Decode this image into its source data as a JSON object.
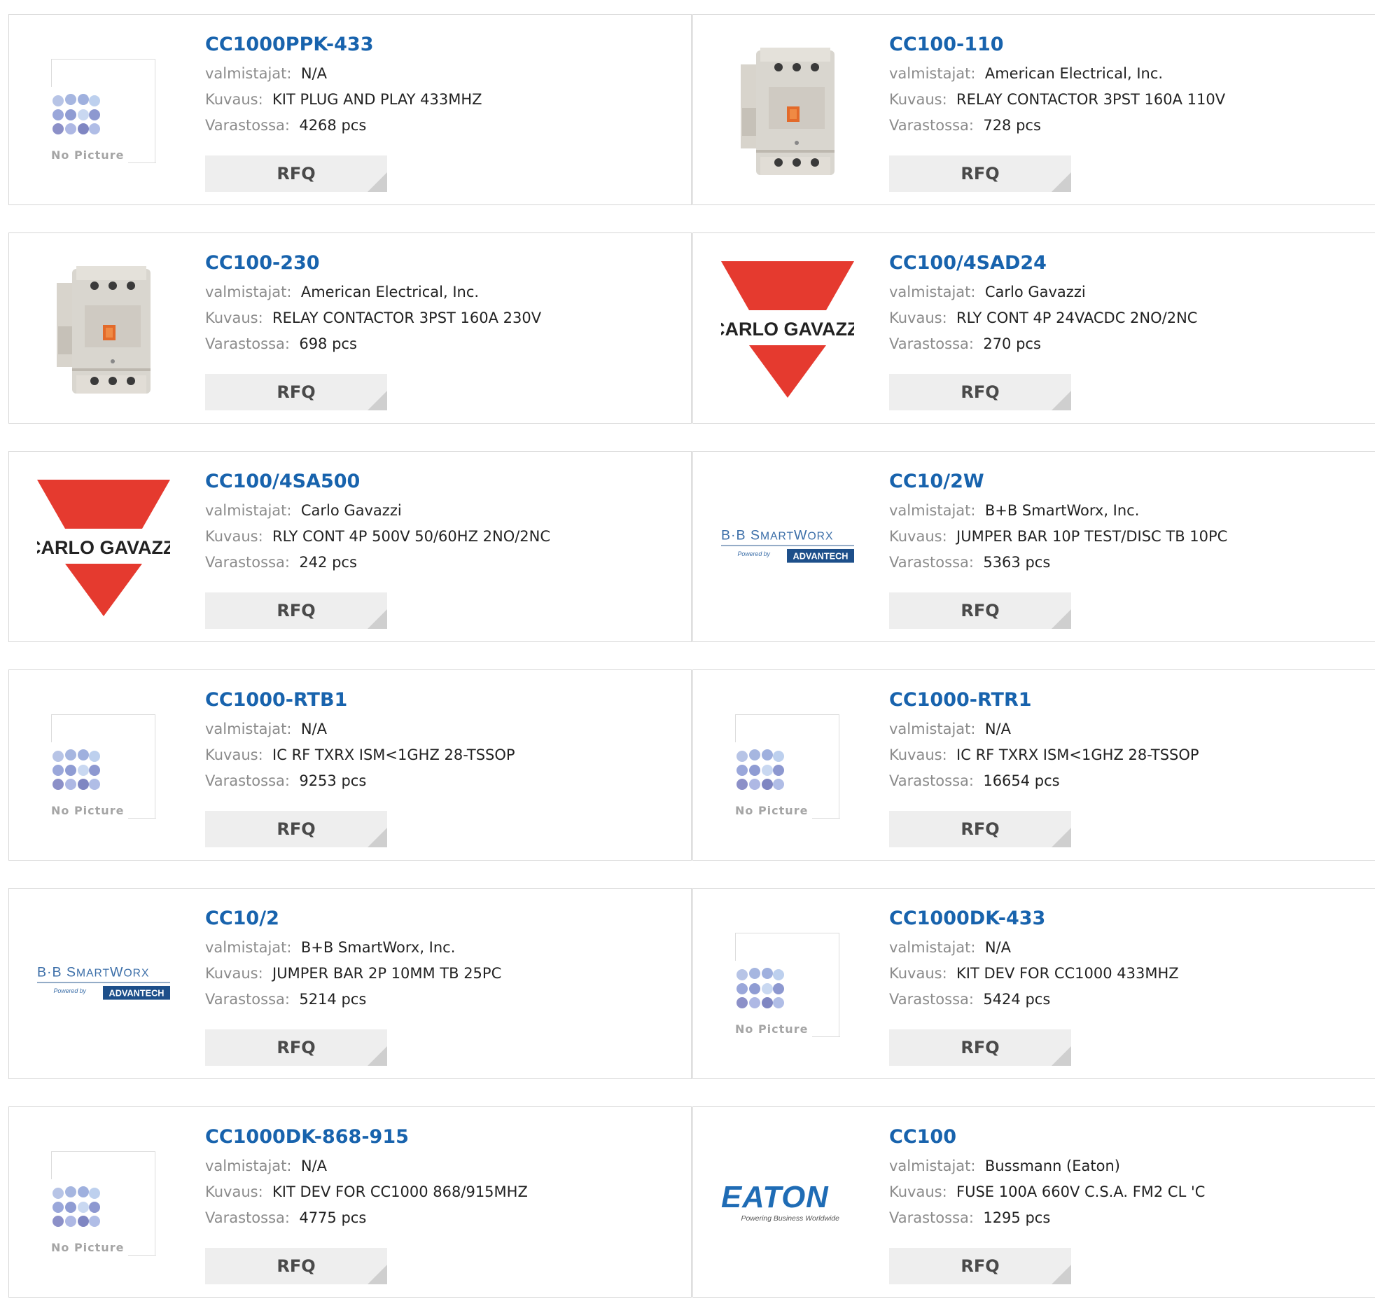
{
  "labels": {
    "manufacturer": "valmistajat:",
    "description": "Kuvaus:",
    "stock": "Varastossa:",
    "rfq": "RFQ",
    "no_picture": "No Picture"
  },
  "brands": {
    "carlo_gavazzi": "CARLO GAVAZZI",
    "bb_top": "B·B SmartWorx",
    "bb_powered": "Powered by",
    "bb_advantech": "ADVANTECH",
    "eaton": "EATON",
    "eaton_tagline": "Powering Business Worldwide"
  },
  "colors": {
    "link": "#1863ad",
    "carlo_red": "#e53a2f",
    "eaton_blue": "#1f6cb5"
  },
  "products": [
    {
      "part": "CC1000PPK-433",
      "manufacturer": "N/A",
      "description": "KIT PLUG AND PLAY 433MHZ",
      "stock": "4268 pcs",
      "image": "no-picture"
    },
    {
      "part": "CC100-110",
      "manufacturer": "American Electrical, Inc.",
      "description": "RELAY CONTACTOR 3PST 160A 110V",
      "stock": "728 pcs",
      "image": "contactor"
    },
    {
      "part": "CC100-230",
      "manufacturer": "American Electrical, Inc.",
      "description": "RELAY CONTACTOR 3PST 160A 230V",
      "stock": "698 pcs",
      "image": "contactor"
    },
    {
      "part": "CC100/4SAD24",
      "manufacturer": "Carlo Gavazzi",
      "description": "RLY CONT 4P 24VACDC 2NO/2NC",
      "stock": "270 pcs",
      "image": "carlo-gavazzi"
    },
    {
      "part": "CC100/4SA500",
      "manufacturer": "Carlo Gavazzi",
      "description": "RLY CONT 4P 500V 50/60HZ 2NO/2NC",
      "stock": "242 pcs",
      "image": "carlo-gavazzi"
    },
    {
      "part": "CC10/2W",
      "manufacturer": "B+B SmartWorx, Inc.",
      "description": "JUMPER BAR 10P TEST/DISC TB 10PC",
      "stock": "5363 pcs",
      "image": "bb-smartworx"
    },
    {
      "part": "CC1000-RTB1",
      "manufacturer": "N/A",
      "description": "IC RF TXRX ISM<1GHZ 28-TSSOP",
      "stock": "9253 pcs",
      "image": "no-picture"
    },
    {
      "part": "CC1000-RTR1",
      "manufacturer": "N/A",
      "description": "IC RF TXRX ISM<1GHZ 28-TSSOP",
      "stock": "16654 pcs",
      "image": "no-picture"
    },
    {
      "part": "CC10/2",
      "manufacturer": "B+B SmartWorx, Inc.",
      "description": "JUMPER BAR 2P 10MM TB 25PC",
      "stock": "5214 pcs",
      "image": "bb-smartworx"
    },
    {
      "part": "CC1000DK-433",
      "manufacturer": "N/A",
      "description": "KIT DEV FOR CC1000 433MHZ",
      "stock": "5424 pcs",
      "image": "no-picture"
    },
    {
      "part": "CC1000DK-868-915",
      "manufacturer": "N/A",
      "description": "KIT DEV FOR CC1000 868/915MHZ",
      "stock": "4775 pcs",
      "image": "no-picture"
    },
    {
      "part": "CC100",
      "manufacturer": "Bussmann (Eaton)",
      "description": "FUSE 100A 660V C.S.A. FM2 CL 'C",
      "stock": "1295 pcs",
      "image": "eaton"
    }
  ]
}
